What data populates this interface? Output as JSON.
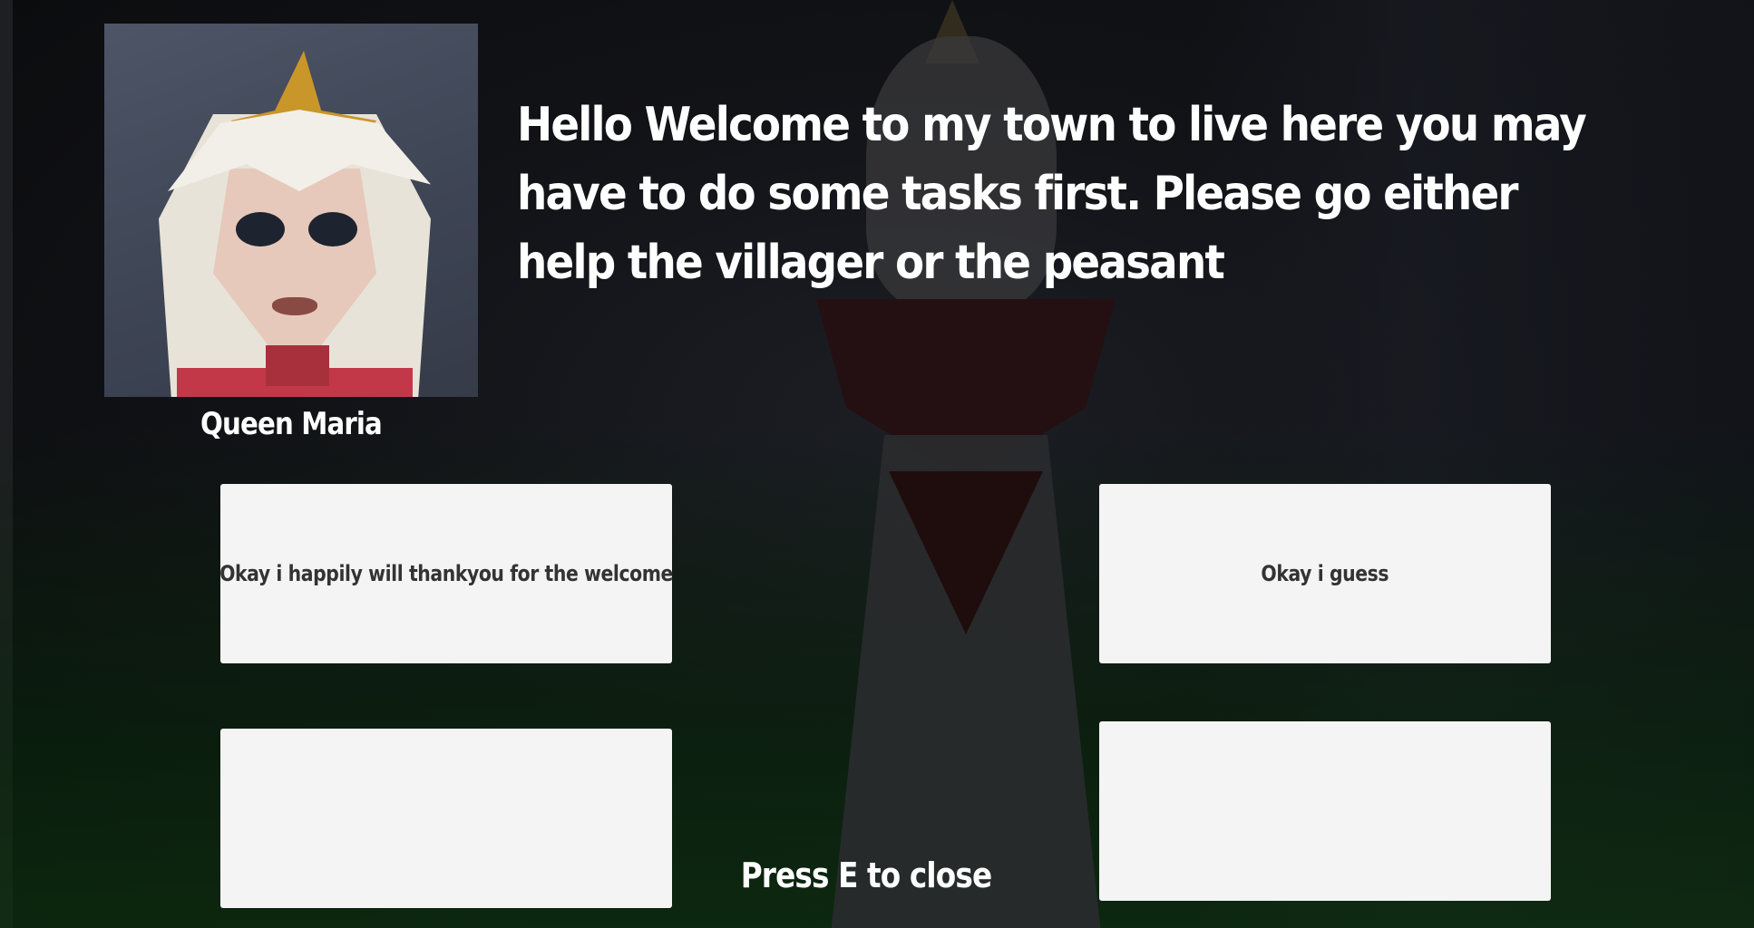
{
  "dialogue": {
    "speaker_name": "Queen Maria",
    "text": "Hello Welcome to my town to live here you may have to do some tasks first. Please go either help the villager or the peasant"
  },
  "choices": [
    {
      "label": "Okay i happily will thankyou for the welcome"
    },
    {
      "label": "Okay i guess"
    },
    {
      "label": ""
    },
    {
      "label": ""
    }
  ],
  "hint": {
    "close_label": "Press E to close"
  },
  "colors": {
    "choice_bg": "#f4f4f4",
    "choice_text": "#333333",
    "ui_text": "#ffffff",
    "portrait_bg": "#4d5566"
  }
}
